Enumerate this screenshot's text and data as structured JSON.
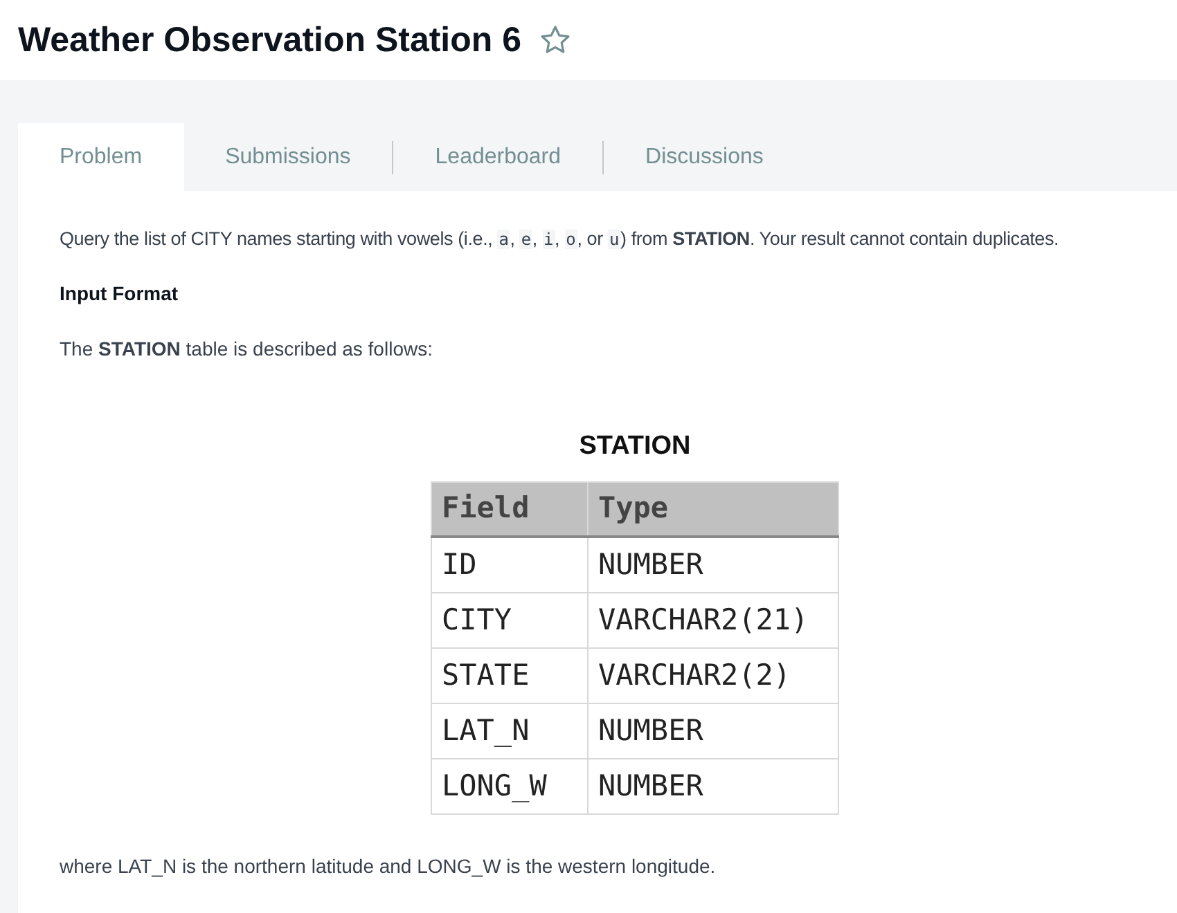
{
  "title": "Weather Observation Station 6",
  "tabs": [
    {
      "label": "Problem",
      "selected": true
    },
    {
      "label": "Submissions",
      "selected": false
    },
    {
      "label": "Leaderboard",
      "selected": false
    },
    {
      "label": "Discussions",
      "selected": false
    }
  ],
  "statement": [
    {
      "kind": "text",
      "text": "Query the list of CITY names starting with vowels (i.e., "
    },
    {
      "kind": "code",
      "text": "a"
    },
    {
      "kind": "text",
      "text": ", "
    },
    {
      "kind": "code",
      "text": "e"
    },
    {
      "kind": "text",
      "text": ", "
    },
    {
      "kind": "code",
      "text": "i"
    },
    {
      "kind": "text",
      "text": ", "
    },
    {
      "kind": "code",
      "text": "o"
    },
    {
      "kind": "text",
      "text": ", or "
    },
    {
      "kind": "code",
      "text": "u"
    },
    {
      "kind": "text",
      "text": ") from "
    },
    {
      "kind": "bold",
      "text": "STATION"
    },
    {
      "kind": "text",
      "text": ". Your result cannot contain duplicates."
    }
  ],
  "input_format_heading": "Input Format",
  "table_intro": "The **STATION** table is described as follows:",
  "table": {
    "title": "STATION",
    "columns": [
      "Field",
      "Type"
    ],
    "rows": [
      [
        "ID",
        "NUMBER"
      ],
      [
        "CITY",
        "VARCHAR2(21)"
      ],
      [
        "STATE",
        "VARCHAR2(2)"
      ],
      [
        "LAT_N",
        "NUMBER"
      ],
      [
        "LONG_W",
        "NUMBER"
      ]
    ]
  },
  "note": "where LAT_N is the northern latitude and LONG_W is the western longitude."
}
